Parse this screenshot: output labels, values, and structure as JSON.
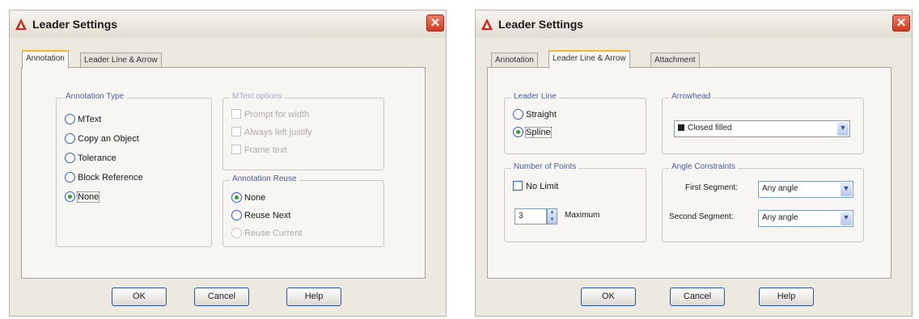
{
  "dialog1": {
    "title": "Leader Settings",
    "close_glyph": "✕",
    "tabs": {
      "annotation": "Annotation",
      "leader_line_arrow": "Leader Line & Arrow"
    },
    "annotation_type": {
      "label": "Annotation Type",
      "options": [
        "MText",
        "Copy an Object",
        "Tolerance",
        "Block Reference",
        "None"
      ],
      "selected": "None"
    },
    "mtext_options": {
      "label": "MText options",
      "options": [
        "Prompt for width",
        "Always left justify",
        "Frame text"
      ],
      "enabled": false
    },
    "annotation_reuse": {
      "label": "Annotation Reuse",
      "options": [
        "None",
        "Reuse Next",
        "Reuse Current"
      ],
      "selected": "None"
    },
    "buttons": {
      "ok": "OK",
      "cancel": "Cancel",
      "help": "Help"
    }
  },
  "dialog2": {
    "title": "Leader Settings",
    "close_glyph": "✕",
    "tabs": {
      "annotation": "Annotation",
      "leader_line_arrow": "Leader Line & Arrow",
      "attachment": "Attachment"
    },
    "leader_line": {
      "label": "Leader Line",
      "options": [
        "Straight",
        "Spline"
      ],
      "selected": "Spline"
    },
    "arrowhead": {
      "label": "Arrowhead",
      "value": "Closed filled"
    },
    "number_of_points": {
      "label": "Number of Points",
      "no_limit_label": "No Limit",
      "no_limit_checked": false,
      "value": "3",
      "maximum_label": "Maximum"
    },
    "angle_constraints": {
      "label": "Angle Constraints",
      "first_segment_label": "First Segment:",
      "first_segment_value": "Any angle",
      "second_segment_label": "Second Segment:",
      "second_segment_value": "Any angle"
    },
    "buttons": {
      "ok": "OK",
      "cancel": "Cancel",
      "help": "Help"
    }
  },
  "icons": {
    "title": "autocad-icon",
    "dropdown": "chevron-down-icon",
    "spin": "spinner-arrows-icon"
  },
  "colors": {
    "close_button": "#d9462d",
    "tab_highlight": "#f1b33c",
    "group_label": "#4a5ca8",
    "selected_radio": "#2fa32f"
  }
}
